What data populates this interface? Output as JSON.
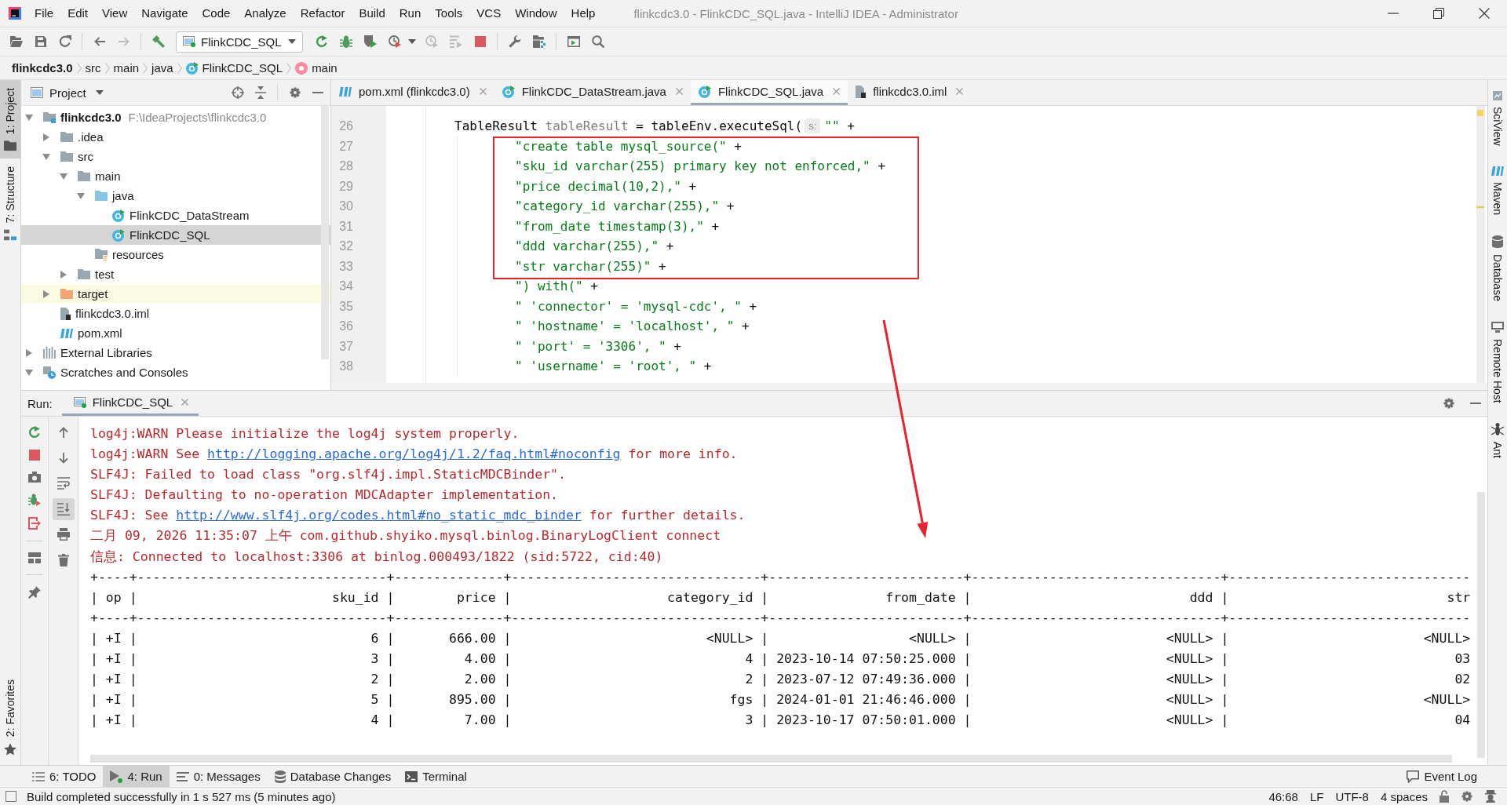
{
  "window": {
    "title": "flinkcdc3.0 - FlinkCDC_SQL.java - IntelliJ IDEA - Administrator"
  },
  "menu": [
    "File",
    "Edit",
    "View",
    "Navigate",
    "Code",
    "Analyze",
    "Refactor",
    "Build",
    "Run",
    "Tools",
    "VCS",
    "Window",
    "Help"
  ],
  "toolbar": [
    {
      "kind": "open",
      "disabled": false
    },
    {
      "kind": "save",
      "disabled": false
    },
    {
      "kind": "sync",
      "disabled": false
    },
    {
      "kind": "separator"
    },
    {
      "kind": "back",
      "disabled": false
    },
    {
      "kind": "forward",
      "disabled": true
    },
    {
      "kind": "separator"
    },
    {
      "kind": "build",
      "disabled": false
    },
    {
      "kind": "run_config",
      "label": "FlinkCDC_SQL"
    },
    {
      "kind": "rerun",
      "disabled": false
    },
    {
      "kind": "debug",
      "disabled": false
    },
    {
      "kind": "coverage",
      "disabled": false
    },
    {
      "kind": "profile",
      "disabled": false
    },
    {
      "kind": "attach",
      "disabled": true
    },
    {
      "kind": "step",
      "disabled": true
    },
    {
      "kind": "stop",
      "disabled": false
    },
    {
      "kind": "separator"
    },
    {
      "kind": "settings",
      "disabled": false
    },
    {
      "kind": "structure",
      "disabled": false
    },
    {
      "kind": "separator"
    },
    {
      "kind": "run_anything",
      "disabled": false
    },
    {
      "kind": "search",
      "disabled": false
    }
  ],
  "breadcrumbs": [
    {
      "kind": "project",
      "label": "flinkcdc3.0"
    },
    {
      "kind": "folder",
      "label": "src"
    },
    {
      "kind": "folder",
      "label": "main"
    },
    {
      "kind": "folder",
      "label": "java"
    },
    {
      "kind": "class",
      "label": "FlinkCDC_SQL"
    },
    {
      "kind": "method",
      "label": "main"
    }
  ],
  "tool_stripes": {
    "left_top": [
      {
        "kind": "project",
        "label": "1: Project",
        "selected": true
      },
      {
        "kind": "structure",
        "label": "7: Structure",
        "selected": false
      }
    ],
    "left_bottom": [
      {
        "kind": "favorites",
        "label": "2: Favorites",
        "selected": false
      }
    ],
    "right": [
      {
        "kind": "sciview",
        "label": "SciView",
        "selected": false
      },
      {
        "kind": "maven",
        "label": "Maven",
        "selected": false
      },
      {
        "kind": "database",
        "label": "Database",
        "selected": false
      },
      {
        "kind": "remote_host",
        "label": "Remote Host",
        "selected": false
      },
      {
        "kind": "ant",
        "label": "Ant",
        "selected": false
      }
    ]
  },
  "project": {
    "title": "Project",
    "tree": [
      {
        "kind": "module",
        "label": "flinkcdc3.0",
        "path": "F:\\IdeaProjects\\flinkcdc3.0",
        "expanded": true,
        "selected": false,
        "children": [
          {
            "kind": "folder",
            "label": ".idea",
            "expanded": false,
            "selected": false
          },
          {
            "kind": "folder",
            "label": "src",
            "expanded": true,
            "selected": false,
            "children": [
              {
                "kind": "folder",
                "label": "main",
                "expanded": true,
                "selected": false,
                "children": [
                  {
                    "kind": "source_folder",
                    "label": "java",
                    "expanded": true,
                    "selected": false,
                    "children": [
                      {
                        "kind": "class",
                        "label": "FlinkCDC_DataStream",
                        "selected": false
                      },
                      {
                        "kind": "class",
                        "label": "FlinkCDC_SQL",
                        "selected": true
                      }
                    ]
                  },
                  {
                    "kind": "resources_folder",
                    "label": "resources",
                    "selected": false
                  }
                ]
              },
              {
                "kind": "folder",
                "label": "test",
                "expanded": false,
                "selected": false
              }
            ]
          },
          {
            "kind": "excluded_folder",
            "label": "target",
            "expanded": false,
            "selected": false
          },
          {
            "kind": "iml_file",
            "label": "flinkcdc3.0.iml",
            "selected": false
          },
          {
            "kind": "maven_file",
            "label": "pom.xml",
            "selected": false
          }
        ]
      },
      {
        "kind": "libraries",
        "label": "External Libraries",
        "expanded": false,
        "selected": false
      },
      {
        "kind": "scratches",
        "label": "Scratches and Consoles",
        "expanded": true,
        "selected": false
      }
    ]
  },
  "editor": {
    "tabs": [
      {
        "kind": "maven",
        "label": "pom.xml (flinkcdc3.0)",
        "selected": false
      },
      {
        "kind": "class",
        "label": "FlinkCDC_DataStream.java",
        "selected": false
      },
      {
        "kind": "class",
        "label": "FlinkCDC_SQL.java",
        "selected": true
      },
      {
        "kind": "iml",
        "label": "flinkcdc3.0.iml",
        "selected": false
      }
    ],
    "lines": [
      {
        "number": "26",
        "tokens": [
          {
            "kind": "plain",
            "text": "TableResult "
          },
          {
            "kind": "unused",
            "text": "tableResult"
          },
          {
            "kind": "plain",
            "text": " = tableEnv.executeSql("
          },
          {
            "kind": "hint",
            "text": "s:"
          },
          {
            "kind": "string",
            "text": "\"\""
          },
          {
            "kind": "plain",
            "text": " +"
          }
        ],
        "children": [
          {
            "number": "27",
            "tokens": [
              {
                "kind": "string",
                "text": "\"create table mysql_source(\""
              },
              {
                "kind": "plain",
                "text": " +"
              }
            ]
          },
          {
            "number": "28",
            "tokens": [
              {
                "kind": "string",
                "text": "\"sku_id varchar(255) primary key not enforced,\""
              },
              {
                "kind": "plain",
                "text": " +"
              }
            ]
          },
          {
            "number": "29",
            "tokens": [
              {
                "kind": "string",
                "text": "\"price decimal(10,2),\""
              },
              {
                "kind": "plain",
                "text": " +"
              }
            ]
          },
          {
            "number": "30",
            "tokens": [
              {
                "kind": "string",
                "text": "\"category_id varchar(255),\""
              },
              {
                "kind": "plain",
                "text": " +"
              }
            ]
          },
          {
            "number": "31",
            "tokens": [
              {
                "kind": "string",
                "text": "\"from_date timestamp(3),\""
              },
              {
                "kind": "plain",
                "text": " +"
              }
            ]
          },
          {
            "number": "32",
            "tokens": [
              {
                "kind": "string",
                "text": "\"ddd varchar(255),\""
              },
              {
                "kind": "plain",
                "text": " +"
              }
            ]
          },
          {
            "number": "33",
            "tokens": [
              {
                "kind": "string",
                "text": "\"str varchar(255)\""
              },
              {
                "kind": "plain",
                "text": " +"
              }
            ]
          },
          {
            "number": "34",
            "tokens": [
              {
                "kind": "string",
                "text": "\") with(\""
              },
              {
                "kind": "plain",
                "text": " +"
              }
            ]
          },
          {
            "number": "35",
            "tokens": [
              {
                "kind": "string",
                "text": "\" 'connector' = 'mysql-cdc', \""
              },
              {
                "kind": "plain",
                "text": " +"
              }
            ]
          },
          {
            "number": "36",
            "tokens": [
              {
                "kind": "string",
                "text": "\" 'hostname' = 'localhost', \""
              },
              {
                "kind": "plain",
                "text": " +"
              }
            ]
          },
          {
            "number": "37",
            "tokens": [
              {
                "kind": "string",
                "text": "\" 'port' = '3306', \""
              },
              {
                "kind": "plain",
                "text": " +"
              }
            ]
          },
          {
            "number": "38",
            "tokens": [
              {
                "kind": "string",
                "text": "\" 'username' = 'root', \""
              },
              {
                "kind": "plain",
                "text": " +"
              }
            ]
          }
        ]
      }
    ]
  },
  "annotations": [
    {
      "kind": "rectangle"
    },
    {
      "kind": "arrow"
    }
  ],
  "run": {
    "label": "Run:",
    "tabs": [
      {
        "label": "FlinkCDC_SQL",
        "selected": true
      }
    ],
    "console_actions": [
      {
        "kind": "up"
      },
      {
        "kind": "down"
      },
      {
        "kind": "wrap",
        "on": false
      },
      {
        "kind": "scroll_end",
        "on": true
      },
      {
        "kind": "print"
      },
      {
        "kind": "trash"
      }
    ],
    "console": [
      {
        "kind": "stderr",
        "parts": [
          {
            "kind": "text",
            "text": "log4j:WARN Please initialize the log4j system properly."
          }
        ]
      },
      {
        "kind": "stderr",
        "parts": [
          {
            "kind": "text",
            "text": "log4j:WARN See "
          },
          {
            "kind": "link",
            "text": "http://logging.apache.org/log4j/1.2/faq.html#noconfig"
          },
          {
            "kind": "text",
            "text": " for more info."
          }
        ]
      },
      {
        "kind": "stderr",
        "parts": [
          {
            "kind": "text",
            "text": "SLF4J: Failed to load class \"org.slf4j.impl.StaticMDCBinder\"."
          }
        ]
      },
      {
        "kind": "stderr",
        "parts": [
          {
            "kind": "text",
            "text": "SLF4J: Defaulting to no-operation MDCAdapter implementation."
          }
        ]
      },
      {
        "kind": "stderr",
        "parts": [
          {
            "kind": "text",
            "text": "SLF4J: See "
          },
          {
            "kind": "link",
            "text": "http://www.slf4j.org/codes.html#no_static_mdc_binder"
          },
          {
            "kind": "text",
            "text": " for further details."
          }
        ]
      },
      {
        "kind": "stderr",
        "parts": [
          {
            "kind": "text",
            "text": "二月 09, 2026 11:35:07 上午 com.github.shyiko.mysql.binlog.BinaryLogClient connect"
          }
        ]
      },
      {
        "kind": "stderr",
        "parts": [
          {
            "kind": "text",
            "text": "信息: Connected to localhost:3306 at binlog.000493/1822 (sid:5722, cid:40)"
          }
        ]
      },
      {
        "kind": "stdout",
        "parts": [
          {
            "kind": "text",
            "text": "+----+--------------------------------+--------------+--------------------------------+-------------------------+--------------------------------+-------------------------------"
          }
        ]
      },
      {
        "kind": "stdout",
        "parts": [
          {
            "kind": "text",
            "text": "| op |                         sku_id |        price |                    category_id |               from_date |                            ddd |                            str"
          }
        ]
      },
      {
        "kind": "stdout",
        "parts": [
          {
            "kind": "text",
            "text": "+----+--------------------------------+--------------+--------------------------------+-------------------------+--------------------------------+-------------------------------"
          }
        ]
      },
      {
        "kind": "stdout",
        "parts": [
          {
            "kind": "text",
            "text": "| +I |                              6 |       666.00 |                         <NULL> |                  <NULL> |                         <NULL> |                         <NULL>"
          }
        ]
      },
      {
        "kind": "stdout",
        "parts": [
          {
            "kind": "text",
            "text": "| +I |                              3 |         4.00 |                              4 | 2023-10-14 07:50:25.000 |                         <NULL> |                             03"
          }
        ]
      },
      {
        "kind": "stdout",
        "parts": [
          {
            "kind": "text",
            "text": "| +I |                              2 |         2.00 |                              2 | 2023-07-12 07:49:36.000 |                         <NULL> |                             02"
          }
        ]
      },
      {
        "kind": "stdout",
        "parts": [
          {
            "kind": "text",
            "text": "| +I |                              5 |       895.00 |                            fgs | 2024-01-01 21:46:46.000 |                         <NULL> |                         <NULL>"
          }
        ]
      },
      {
        "kind": "stdout",
        "parts": [
          {
            "kind": "text",
            "text": "| +I |                              4 |         7.00 |                              3 | 2023-10-17 07:50:01.000 |                         <NULL> |                             04"
          }
        ]
      }
    ]
  },
  "tool_windows": [
    {
      "kind": "todo",
      "label": "6: TODO",
      "selected": false
    },
    {
      "kind": "run",
      "label": "4: Run",
      "selected": true
    },
    {
      "kind": "messages",
      "label": "0: Messages",
      "selected": false
    },
    {
      "kind": "database_changes",
      "label": "Database Changes",
      "selected": false
    },
    {
      "kind": "terminal",
      "label": "Terminal",
      "selected": false
    }
  ],
  "event_log": "Event Log",
  "status_bar": {
    "message": "Build completed successfully in 1 s 527 ms (5 minutes ago)",
    "caret_position": "46:68",
    "line_separator": "LF",
    "encoding": "UTF-8",
    "indent": "4 spaces"
  }
}
